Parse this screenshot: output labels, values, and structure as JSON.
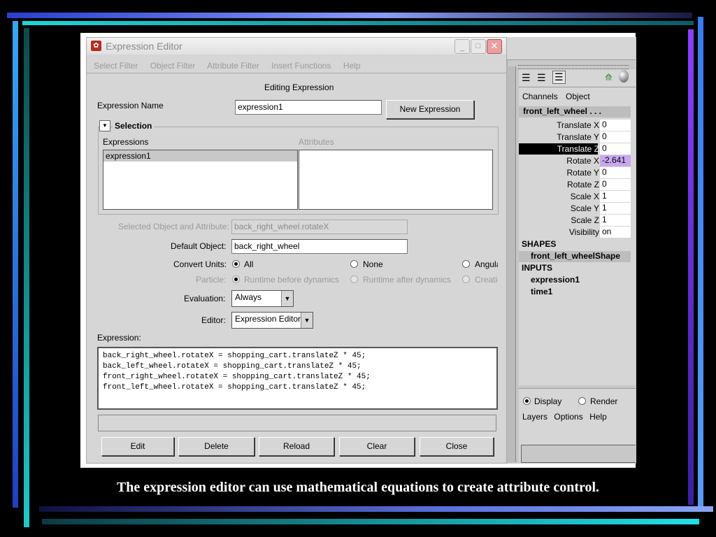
{
  "window": {
    "title": "Expression Editor"
  },
  "menu": [
    "Select Filter",
    "Object Filter",
    "Attribute Filter",
    "Insert Functions",
    "Help"
  ],
  "editing_label": "Editing Expression",
  "expression_name": {
    "label": "Expression Name",
    "value": "expression1"
  },
  "new_expression_button": "New Expression",
  "selection": {
    "title": "Selection",
    "expressions_label": "Expressions",
    "attributes_label": "Attributes",
    "expressions": [
      "expression1"
    ]
  },
  "selected_object": {
    "label": "Selected Object and Attribute:",
    "value": "back_right_wheel.rotateX"
  },
  "default_object": {
    "label": "Default Object:",
    "value": "back_right_wheel"
  },
  "convert_units": {
    "label": "Convert Units:",
    "options": [
      "All",
      "None",
      "Angula"
    ],
    "selected": "All"
  },
  "particle": {
    "label": "Particle:",
    "options": [
      "Runtime before dynamics",
      "Runtime after dynamics",
      "Creatic"
    ],
    "selected": "Runtime before dynamics"
  },
  "evaluation": {
    "label": "Evaluation:",
    "value": "Always"
  },
  "editor": {
    "label": "Editor:",
    "value": "Expression Editor"
  },
  "expression": {
    "label": "Expression:",
    "lines": [
      "back_right_wheel.rotateX = shopping_cart.translateZ * 45;",
      "back_left_wheel.rotateX = shopping_cart.translateZ * 45;",
      "front_right_wheel.rotateX = shopping_cart.translateZ * 45;",
      "front_left_wheel.rotateX = shopping_cart.translateZ * 45;"
    ]
  },
  "buttons": {
    "edit": "Edit",
    "delete": "Delete",
    "reload": "Reload",
    "clear": "Clear",
    "close": "Close"
  },
  "channel_box": {
    "menu": [
      "Channels",
      "Object"
    ],
    "object_name": "front_left_wheel . . .",
    "channels": [
      {
        "name": "Translate X",
        "value": "0"
      },
      {
        "name": "Translate Y",
        "value": "0"
      },
      {
        "name": "Translate Z",
        "value": "0"
      },
      {
        "name": "Rotate X",
        "value": "-2.641"
      },
      {
        "name": "Rotate Y",
        "value": "0"
      },
      {
        "name": "Rotate Z",
        "value": "0"
      },
      {
        "name": "Scale X",
        "value": "1"
      },
      {
        "name": "Scale Y",
        "value": "1"
      },
      {
        "name": "Scale Z",
        "value": "1"
      },
      {
        "name": "Visibility",
        "value": "on"
      }
    ],
    "shapes_header": "SHAPES",
    "shape": "front_left_wheelShape",
    "inputs_header": "INPUTS",
    "inputs": [
      "expression1",
      "time1"
    ],
    "display_label": "Display",
    "render_label": "Render",
    "layers_menu": [
      "Layers",
      "Options",
      "Help"
    ]
  },
  "caption": "The expression editor can use mathematical equations to create attribute control.",
  "colors": {
    "selected_channel_bg": "#000000",
    "highlight_value_bg": "#c8a8f0",
    "accent_bar": "#5a6cf0"
  }
}
